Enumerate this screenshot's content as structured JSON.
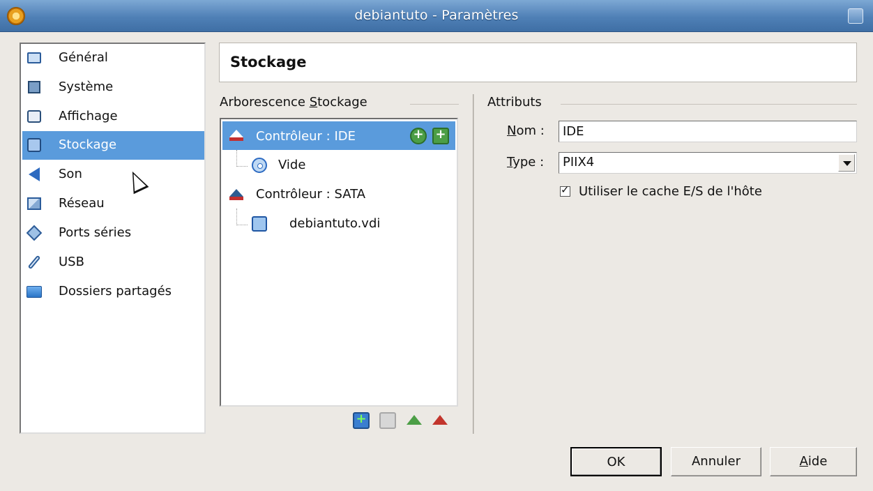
{
  "window": {
    "title": "debiantuto - Paramètres",
    "app_icon": "virtualbox-icon",
    "close_icon": "close-icon"
  },
  "sidebar": {
    "items": [
      {
        "label": "Général",
        "icon": "monitor-icon"
      },
      {
        "label": "Système",
        "icon": "chip-icon"
      },
      {
        "label": "Affichage",
        "icon": "display-icon"
      },
      {
        "label": "Stockage",
        "icon": "storage-icon",
        "selected": true
      },
      {
        "label": "Son",
        "icon": "speaker-icon"
      },
      {
        "label": "Réseau",
        "icon": "network-icon"
      },
      {
        "label": "Ports séries",
        "icon": "serial-port-icon"
      },
      {
        "label": "USB",
        "icon": "usb-icon"
      },
      {
        "label": "Dossiers partagés",
        "icon": "folder-icon"
      }
    ]
  },
  "header": {
    "title": "Stockage"
  },
  "storage_tree": {
    "group_prefix": "Arborescence ",
    "group_mnemonic": "S",
    "group_suffix": "tockage",
    "nodes": [
      {
        "label": "Contrôleur : IDE",
        "icon": "ide-controller-icon",
        "selected": true
      },
      {
        "label": "Vide",
        "icon": "cd-icon"
      },
      {
        "label": "Contrôleur : SATA",
        "icon": "sata-controller-icon"
      },
      {
        "label": "debiantuto.vdi",
        "icon": "hard-disk-icon"
      }
    ],
    "row_actions": [
      "add-cd-icon",
      "add-hard-disk-icon"
    ],
    "toolbar": [
      "add-attachment-icon",
      "remove-attachment-icon",
      "add-controller-icon",
      "remove-controller-icon"
    ]
  },
  "attributes": {
    "group_title": "Attributs",
    "name_mnemonic": "N",
    "name_rest": "om :",
    "name_value": "IDE",
    "type_mnemonic": "T",
    "type_rest": "ype :",
    "type_value": "PIIX4",
    "cache_label": "Utiliser le cache E/S de l'hôte",
    "cache_checked": true
  },
  "buttons": {
    "ok": "OK",
    "cancel": "Annuler",
    "help_mnemonic": "A",
    "help_rest": "ide"
  }
}
